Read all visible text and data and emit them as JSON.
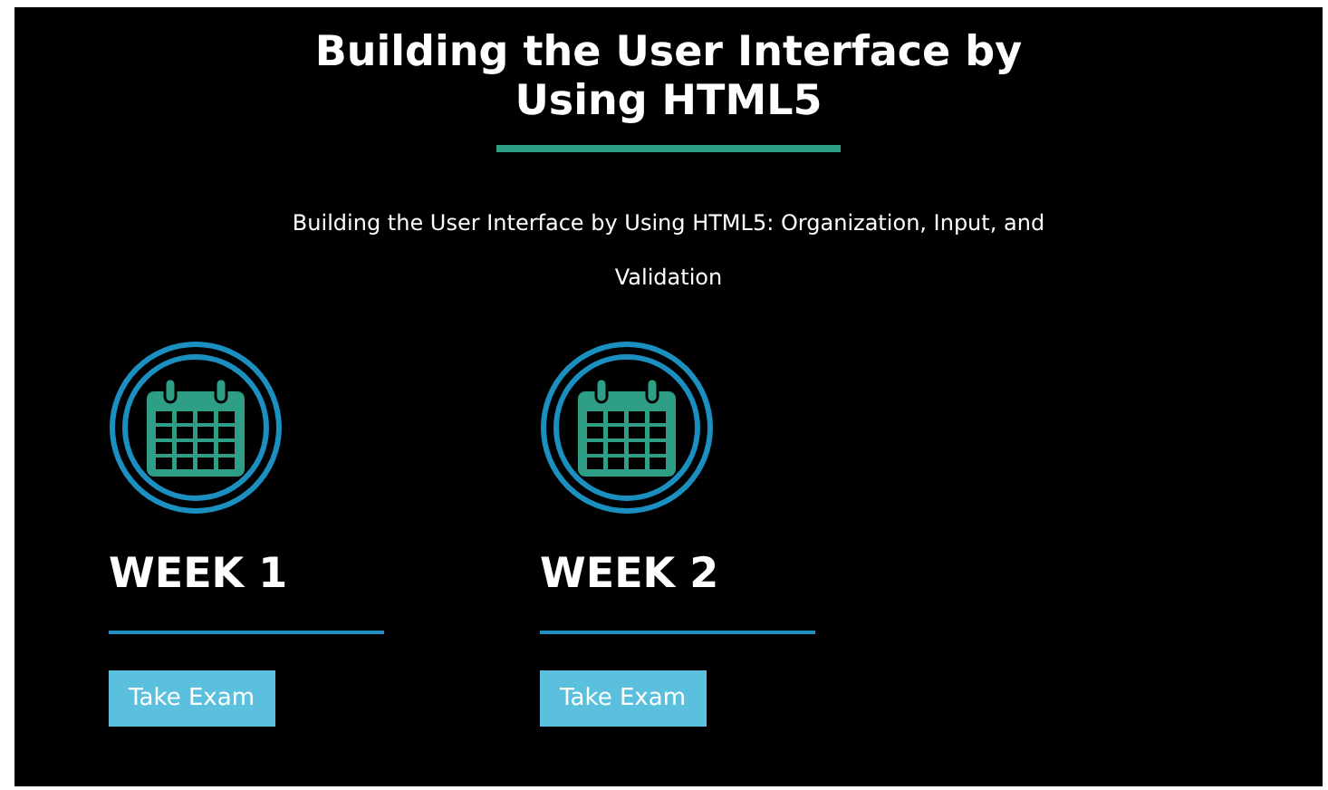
{
  "title": "Building the User Interface by Using HTML5",
  "subtitle": "Building the User Interface by Using HTML5: Organization, Input, and Validation",
  "weeks": [
    {
      "label": "WEEK 1",
      "button": "Take Exam"
    },
    {
      "label": "WEEK 2",
      "button": "Take Exam"
    }
  ]
}
